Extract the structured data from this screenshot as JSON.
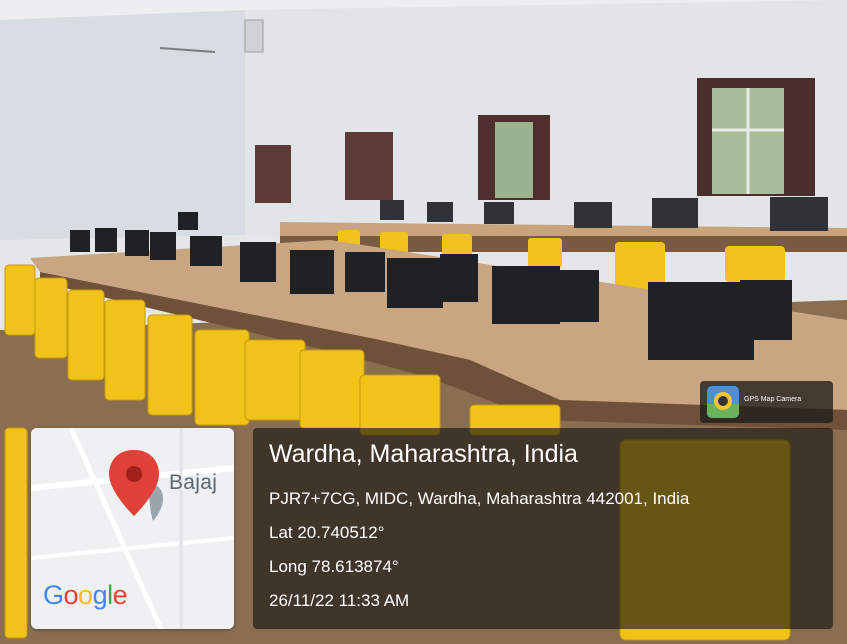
{
  "photo": {
    "subject": "computer-lab"
  },
  "badge": {
    "app_name": "GPS Map Camera",
    "icon": "gps-map-camera-icon"
  },
  "map": {
    "place_label": "Bajaj",
    "pin_icon": "map-pin-icon",
    "logo": {
      "letters": [
        "G",
        "o",
        "o",
        "g",
        "l",
        "e"
      ],
      "colors": [
        "#4285F4",
        "#EA4335",
        "#FBBC05",
        "#4285F4",
        "#34A853",
        "#EA4335"
      ]
    }
  },
  "location": {
    "title": "Wardha, Maharashtra, India",
    "address": "PJR7+7CG, MIDC, Wardha, Maharashtra 442001, India",
    "lat": "Lat 20.740512°",
    "long": "Long 78.613874°",
    "datetime": "26/11/22 11:33 AM"
  },
  "colors": {
    "wall": "#dfe3e6",
    "floor": "#8a6e52",
    "desk": "#c9a581",
    "chair": "#f0c21a",
    "overlay": "#141210",
    "pin": "#e2413a"
  }
}
